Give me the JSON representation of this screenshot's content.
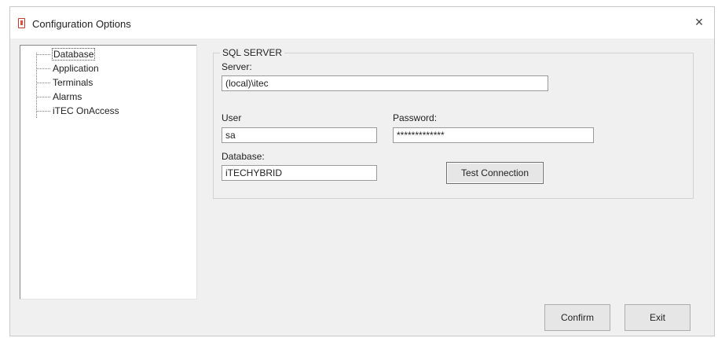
{
  "window": {
    "title": "Configuration Options",
    "close_glyph": "×"
  },
  "tree": {
    "items": [
      {
        "label": "Database",
        "selected": true
      },
      {
        "label": "Application"
      },
      {
        "label": "Terminals"
      },
      {
        "label": "Alarms"
      },
      {
        "label": "iTEC OnAccess"
      }
    ]
  },
  "sql_group": {
    "legend": "SQL SERVER",
    "server_label": "Server:",
    "server_value": "(local)\\itec",
    "user_label": "User",
    "user_value": "sa",
    "password_label": "Password:",
    "password_value": "*************",
    "database_label": "Database:",
    "database_value": "iTECHYBRID",
    "test_button": "Test Connection"
  },
  "footer": {
    "confirm_button": "Confirm",
    "exit_button": "Exit"
  }
}
